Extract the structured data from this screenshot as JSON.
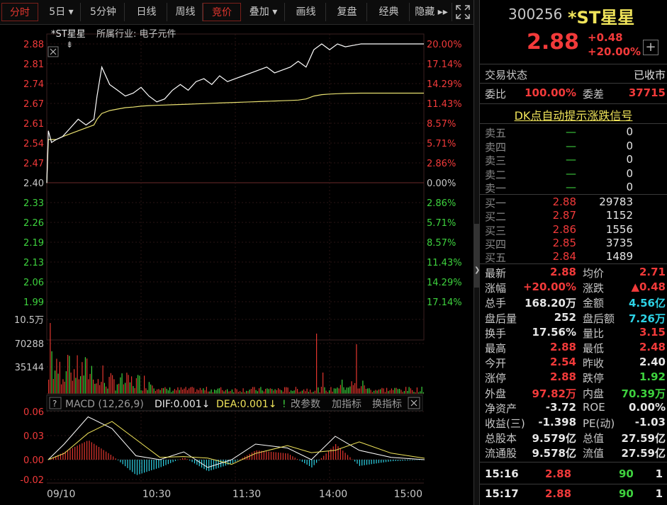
{
  "toolbar": {
    "tabs": [
      {
        "label": "分时",
        "active": true
      },
      {
        "label": "5日 ▾"
      },
      {
        "label": "5分钟"
      },
      {
        "label": "日线"
      },
      {
        "label": "周线"
      },
      {
        "label": "竞价",
        "active": true
      },
      {
        "label": "叠加 ▾"
      },
      {
        "label": "画线"
      },
      {
        "label": "复盘"
      },
      {
        "label": "经典"
      },
      {
        "label": "隐藏 ▸▸"
      }
    ]
  },
  "chart": {
    "stock_label": "*ST星星",
    "industry_label": "所属行业: 电子元件",
    "price_ticks": [
      "2.88",
      "2.81",
      "2.74",
      "2.67",
      "2.61",
      "2.54",
      "2.47",
      "2.40",
      "2.33",
      "2.26",
      "2.19",
      "2.13",
      "2.06",
      "1.99"
    ],
    "pct_ticks": [
      "20.00%",
      "17.14%",
      "14.29%",
      "11.43%",
      "8.57%",
      "5.71%",
      "2.86%",
      "0.00%",
      "2.86%",
      "5.71%",
      "8.57%",
      "11.43%",
      "14.29%",
      "17.14%"
    ],
    "vol_ticks": [
      "10.5万",
      "70288",
      "35144"
    ],
    "macd_title": "MACD (12,26,9)",
    "dif_label": "DIF:0.001↓",
    "dea_label": "DEA:0.001↓",
    "macd_buttons": [
      "改参数",
      "加指标",
      "换指标"
    ],
    "macd_ticks": [
      "0.06",
      "0.03",
      "0.00",
      "-0.02"
    ],
    "time_ticks": [
      "09/10",
      "10:30",
      "11:30",
      "14:00",
      "15:00"
    ]
  },
  "chart_data": {
    "type": "line",
    "prev_close": 2.4,
    "ylim": [
      1.92,
      2.88
    ],
    "x": [
      "09:30",
      "09:31",
      "09:33",
      "09:36",
      "09:40",
      "09:45",
      "09:50",
      "09:55",
      "10:00",
      "10:02",
      "10:05",
      "10:10",
      "10:15",
      "10:20",
      "10:25",
      "10:30",
      "10:35",
      "10:40",
      "10:45",
      "10:50",
      "10:55",
      "11:00",
      "11:05",
      "11:10",
      "11:15",
      "11:20",
      "11:25",
      "11:30",
      "13:05",
      "13:10",
      "13:15",
      "13:20",
      "13:25",
      "13:30",
      "13:35",
      "13:40",
      "13:45",
      "13:50",
      "13:55",
      "14:00",
      "14:05",
      "14:10",
      "14:20",
      "14:30",
      "14:40",
      "14:50",
      "15:00"
    ],
    "series": [
      {
        "values": [
          2.4,
          2.58,
          2.54,
          2.55,
          2.56,
          2.59,
          2.62,
          2.6,
          2.62,
          2.7,
          2.8,
          2.74,
          2.72,
          2.7,
          2.71,
          2.73,
          2.7,
          2.68,
          2.69,
          2.72,
          2.74,
          2.72,
          2.75,
          2.76,
          2.74,
          2.77,
          2.75,
          2.76,
          2.77,
          2.78,
          2.79,
          2.8,
          2.78,
          2.79,
          2.8,
          2.82,
          2.8,
          2.86,
          2.88,
          2.86,
          2.88,
          2.87,
          2.88,
          2.88,
          2.88,
          2.88,
          2.88
        ]
      },
      {
        "values": [
          2.4,
          2.55,
          2.55,
          2.55,
          2.56,
          2.57,
          2.58,
          2.59,
          2.6,
          2.62,
          2.64,
          2.65,
          2.655,
          2.66,
          2.662,
          2.665,
          2.667,
          2.668,
          2.669,
          2.67,
          2.671,
          2.672,
          2.673,
          2.674,
          2.675,
          2.676,
          2.677,
          2.678,
          2.679,
          2.68,
          2.681,
          2.682,
          2.683,
          2.684,
          2.685,
          2.686,
          2.69,
          2.7,
          2.705,
          2.707,
          2.708,
          2.709,
          2.71,
          2.71,
          2.71,
          2.71,
          2.71
        ]
      }
    ]
  },
  "panel": {
    "code": "300256",
    "name": "*ST星星",
    "price": "2.88",
    "change": "+0.48",
    "change_pct": "+20.00%",
    "plus_btn": "+",
    "status_label": "交易状态",
    "status_value": "已收市",
    "wb_label": "委比",
    "wb_value": "100.00%",
    "wc_label": "委差",
    "wc_value": "37715",
    "dk_link": "DK点自动提示涨跌信号",
    "sell": [
      {
        "label": "卖五",
        "price": "—",
        "vol": "0"
      },
      {
        "label": "卖四",
        "price": "—",
        "vol": "0"
      },
      {
        "label": "卖三",
        "price": "—",
        "vol": "0"
      },
      {
        "label": "卖二",
        "price": "—",
        "vol": "0"
      },
      {
        "label": "卖一",
        "price": "—",
        "vol": "0"
      }
    ],
    "buy": [
      {
        "label": "买一",
        "price": "2.88",
        "vol": "29783"
      },
      {
        "label": "买二",
        "price": "2.87",
        "vol": "1152"
      },
      {
        "label": "买三",
        "price": "2.86",
        "vol": "1556"
      },
      {
        "label": "买四",
        "price": "2.85",
        "vol": "3735"
      },
      {
        "label": "买五",
        "price": "2.84",
        "vol": "1489"
      }
    ],
    "stats": [
      {
        "l1": "最新",
        "v1": "2.88",
        "c1": "red",
        "l2": "均价",
        "v2": "2.71",
        "c2": "red"
      },
      {
        "l1": "涨幅",
        "v1": "+20.00%",
        "c1": "red",
        "l2": "涨跌",
        "v2": "▲0.48",
        "c2": "red"
      },
      {
        "l1": "总手",
        "v1": "168.20万",
        "c1": "white",
        "l2": "金额",
        "v2": "4.56亿",
        "c2": "cyan"
      },
      {
        "l1": "盘后量",
        "v1": "252",
        "c1": "white",
        "l2": "盘后额",
        "v2": "7.26万",
        "c2": "cyan"
      },
      {
        "l1": "换手",
        "v1": "17.56%",
        "c1": "white",
        "l2": "量比",
        "v2": "3.15",
        "c2": "red"
      },
      {
        "l1": "最高",
        "v1": "2.88",
        "c1": "red",
        "l2": "最低",
        "v2": "2.48",
        "c2": "red"
      },
      {
        "l1": "今开",
        "v1": "2.54",
        "c1": "red",
        "l2": "昨收",
        "v2": "2.40",
        "c2": "white"
      },
      {
        "l1": "涨停",
        "v1": "2.88",
        "c1": "red",
        "l2": "跌停",
        "v2": "1.92",
        "c2": "green"
      },
      {
        "l1": "外盘",
        "v1": "97.82万",
        "c1": "red",
        "l2": "内盘",
        "v2": "70.39万",
        "c2": "green"
      },
      {
        "l1": "净资产",
        "v1": "-3.72",
        "c1": "white",
        "l2": "ROE",
        "v2": "0.00%",
        "c2": "white"
      },
      {
        "l1": "收益(三)",
        "v1": "-1.398",
        "c1": "white",
        "l2": "PE(动)",
        "v2": "-1.03",
        "c2": "white"
      },
      {
        "l1": "总股本",
        "v1": "9.579亿",
        "c1": "white",
        "l2": "总值",
        "v2": "27.59亿",
        "c2": "white"
      },
      {
        "l1": "流通股",
        "v1": "9.578亿",
        "c1": "white",
        "l2": "流值",
        "v2": "27.59亿",
        "c2": "white"
      }
    ],
    "ticks": [
      {
        "time": "15:16",
        "price": "2.88",
        "vol": "90",
        "n": "1"
      },
      {
        "time": "15:17",
        "price": "2.88",
        "vol": "90",
        "n": "1"
      }
    ]
  }
}
